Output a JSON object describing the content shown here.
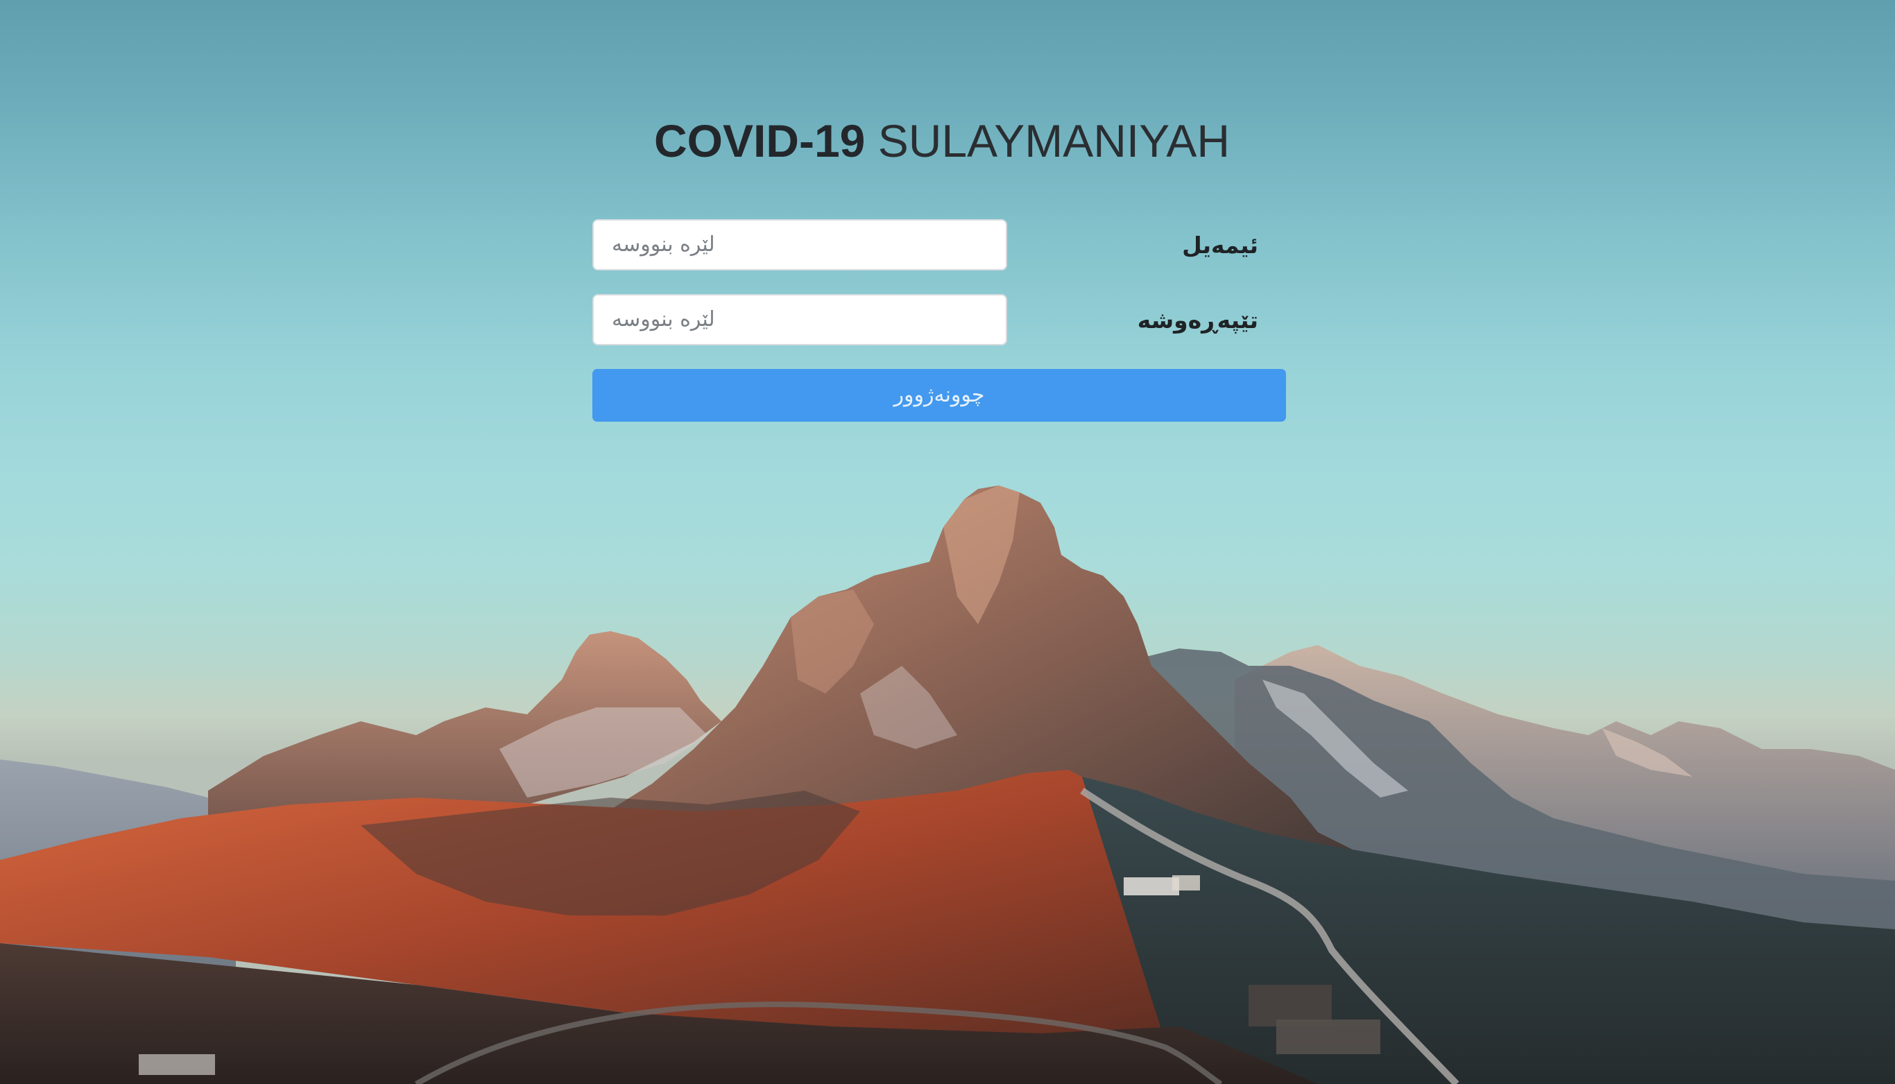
{
  "header": {
    "title_bold": "COVID-19",
    "title_light": "SULAYMANIYAH"
  },
  "form": {
    "email_label": "ئیمەیل",
    "email_placeholder": "لێرە بنووسە",
    "password_label": "تێپەڕەوشە",
    "password_placeholder": "لێرە بنووسە",
    "login_label": "چوونەژوور"
  },
  "colors": {
    "button": "#4299ef",
    "title": "#23272b"
  }
}
